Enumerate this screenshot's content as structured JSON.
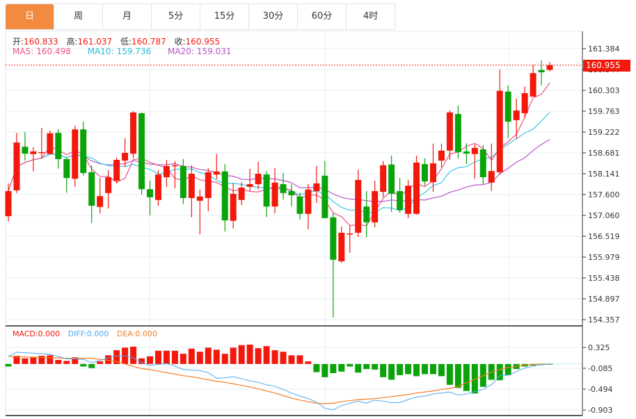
{
  "tabs": [
    "日",
    "周",
    "月",
    "5分",
    "15分",
    "30分",
    "60分",
    "4时"
  ],
  "active_tab": 0,
  "ohlc": {
    "open_label": "开:",
    "open": "160.833",
    "high_label": "高:",
    "high": "161.037",
    "low_label": "低:",
    "low": "160.787",
    "close_label": "收:",
    "close": "160.955"
  },
  "ma": {
    "ma5_label": "MA5:",
    "ma5": "160.498",
    "ma10_label": "MA10:",
    "ma10": "159.736",
    "ma20_label": "MA20:",
    "ma20": "159.031"
  },
  "macd_legend": {
    "macd": "MACD:0.000",
    "diff": "DIFF:0.000",
    "dea": "DEA:0.000"
  },
  "current_price": "160.955",
  "colors": {
    "up": "#f2180c",
    "down": "#0aa40a",
    "ma5": "#f0508a",
    "ma10": "#3cc8e0",
    "ma20": "#b855c8",
    "diff": "#4aa8f0",
    "dea": "#f57c1f",
    "accent": "#f28a3f"
  },
  "chart_data": {
    "type": "candlestick",
    "price_axis": {
      "ticks": [
        "161.384",
        "160.844",
        "160.303",
        "159.763",
        "159.222",
        "158.681",
        "158.141",
        "157.600",
        "157.060",
        "156.519",
        "155.979",
        "155.438",
        "154.897",
        "154.357"
      ],
      "range": [
        154.357,
        161.384
      ]
    },
    "macd_axis": {
      "ticks": [
        "0.325",
        "-0.085",
        "-0.494",
        "-0.903"
      ]
    },
    "candles": [
      [
        157.04,
        157.89,
        156.9,
        157.69
      ],
      [
        157.71,
        159.2,
        157.64,
        158.95
      ],
      [
        158.84,
        159.22,
        158.48,
        158.66
      ],
      [
        158.65,
        158.83,
        158.2,
        158.72
      ],
      [
        158.7,
        159.33,
        158.54,
        158.7
      ],
      [
        158.65,
        159.26,
        158.65,
        159.19
      ],
      [
        159.2,
        159.29,
        158.27,
        158.52
      ],
      [
        158.52,
        158.57,
        157.65,
        158.03
      ],
      [
        158.01,
        159.38,
        157.8,
        159.29
      ],
      [
        159.29,
        159.49,
        158.09,
        158.16
      ],
      [
        158.18,
        158.36,
        156.86,
        157.31
      ],
      [
        157.28,
        158.03,
        157.11,
        157.56
      ],
      [
        157.64,
        158.23,
        157.24,
        158.05
      ],
      [
        157.96,
        158.56,
        157.89,
        158.5
      ],
      [
        158.48,
        159.06,
        158.32,
        158.68
      ],
      [
        158.66,
        159.76,
        158.54,
        159.73
      ],
      [
        159.71,
        159.73,
        157.6,
        157.74
      ],
      [
        157.74,
        157.96,
        157.06,
        157.53
      ],
      [
        157.46,
        158.23,
        157.31,
        158.12
      ],
      [
        158.05,
        158.5,
        157.8,
        158.34
      ],
      [
        158.36,
        158.47,
        157.76,
        158.36
      ],
      [
        158.34,
        158.52,
        157.35,
        157.51
      ],
      [
        157.51,
        158.36,
        157.01,
        158.14
      ],
      [
        157.44,
        157.73,
        156.57,
        157.55
      ],
      [
        157.51,
        158.29,
        157.17,
        158.18
      ],
      [
        158.12,
        158.65,
        158.0,
        158.2
      ],
      [
        158.2,
        158.39,
        156.64,
        156.93
      ],
      [
        156.92,
        157.89,
        156.72,
        157.62
      ],
      [
        157.46,
        157.92,
        157.33,
        157.78
      ],
      [
        157.8,
        158.27,
        157.69,
        157.87
      ],
      [
        157.87,
        158.45,
        157.74,
        158.14
      ],
      [
        158.12,
        158.21,
        157.02,
        157.29
      ],
      [
        157.29,
        158.29,
        157.11,
        157.91
      ],
      [
        157.87,
        158.16,
        157.47,
        157.64
      ],
      [
        157.69,
        157.87,
        157.29,
        157.58
      ],
      [
        157.55,
        157.65,
        156.95,
        157.1
      ],
      [
        157.1,
        157.87,
        156.7,
        157.73
      ],
      [
        157.69,
        158.34,
        157.38,
        157.89
      ],
      [
        158.09,
        158.47,
        156.99,
        156.99
      ],
      [
        157.01,
        157.13,
        154.41,
        155.91
      ],
      [
        155.87,
        156.77,
        155.83,
        156.61
      ],
      [
        156.59,
        156.79,
        156.09,
        156.59
      ],
      [
        156.61,
        158.25,
        156.5,
        157.98
      ],
      [
        157.29,
        157.69,
        156.5,
        156.88
      ],
      [
        156.88,
        157.96,
        156.75,
        157.69
      ],
      [
        157.67,
        158.47,
        157.53,
        158.36
      ],
      [
        158.38,
        158.61,
        157.15,
        157.62
      ],
      [
        157.69,
        158.03,
        157.13,
        157.2
      ],
      [
        157.1,
        157.98,
        156.99,
        157.83
      ],
      [
        157.1,
        158.61,
        157.08,
        158.43
      ],
      [
        158.39,
        158.54,
        157.83,
        157.94
      ],
      [
        157.92,
        158.92,
        157.67,
        158.41
      ],
      [
        158.48,
        158.92,
        158.3,
        158.74
      ],
      [
        158.74,
        159.78,
        158.5,
        159.73
      ],
      [
        159.69,
        159.91,
        158.54,
        158.7
      ],
      [
        158.72,
        158.93,
        158.39,
        158.66
      ],
      [
        158.65,
        158.9,
        158.01,
        158.81
      ],
      [
        158.77,
        158.88,
        157.87,
        158.05
      ],
      [
        157.91,
        158.92,
        157.69,
        158.21
      ],
      [
        158.18,
        160.84,
        158.12,
        160.29
      ],
      [
        160.27,
        160.43,
        159.06,
        159.49
      ],
      [
        159.53,
        160.09,
        159.04,
        159.78
      ],
      [
        159.71,
        160.4,
        159.58,
        160.23
      ],
      [
        160.14,
        160.97,
        160.14,
        160.75
      ],
      [
        160.83,
        161.08,
        160.43,
        160.77
      ],
      [
        160.833,
        161.037,
        160.787,
        160.955
      ]
    ],
    "macd_hist": [
      -0.05,
      0.16,
      0.11,
      0.14,
      0.16,
      0.17,
      0.08,
      0.06,
      0.13,
      -0.05,
      -0.08,
      0.05,
      0.17,
      0.27,
      0.32,
      0.34,
      0.11,
      0.15,
      0.26,
      0.26,
      0.26,
      0.2,
      0.3,
      0.24,
      0.32,
      0.28,
      0.2,
      0.32,
      0.37,
      0.38,
      0.31,
      0.35,
      0.27,
      0.24,
      0.17,
      0.17,
      0.05,
      -0.16,
      -0.26,
      -0.18,
      -0.15,
      -0.05,
      -0.17,
      -0.1,
      -0.11,
      -0.26,
      -0.31,
      -0.22,
      -0.2,
      -0.24,
      -0.2,
      -0.2,
      -0.24,
      -0.41,
      -0.47,
      -0.53,
      -0.58,
      -0.45,
      -0.31,
      -0.32,
      -0.22,
      -0.1,
      -0.05,
      -0.03,
      -0.02,
      -0.01
    ],
    "dea": [
      0.15,
      0.14,
      0.14,
      0.13,
      0.13,
      0.12,
      0.12,
      0.11,
      0.11,
      0.11,
      0.11,
      0.09,
      0.07,
      0.05,
      0,
      -0.05,
      -0.09,
      -0.11,
      -0.14,
      -0.17,
      -0.2,
      -0.23,
      -0.25,
      -0.28,
      -0.31,
      -0.34,
      -0.36,
      -0.39,
      -0.42,
      -0.45,
      -0.49,
      -0.53,
      -0.57,
      -0.62,
      -0.67,
      -0.71,
      -0.74,
      -0.77,
      -0.78,
      -0.77,
      -0.74,
      -0.72,
      -0.7,
      -0.69,
      -0.68,
      -0.66,
      -0.64,
      -0.62,
      -0.6,
      -0.57,
      -0.55,
      -0.53,
      -0.5,
      -0.48,
      -0.44,
      -0.37,
      -0.3,
      -0.23,
      -0.16,
      -0.11,
      -0.07,
      -0.05,
      -0.02,
      -0.01,
      0,
      0
    ],
    "diff": [
      0.15,
      0.23,
      0.22,
      0.21,
      0.2,
      0.19,
      0.15,
      0.1,
      0.1,
      0.09,
      0.03,
      0.07,
      0.12,
      0.16,
      0.16,
      0.12,
      0.03,
      -0.03,
      -0.01,
      0.01,
      -0.04,
      -0.11,
      -0.12,
      -0.13,
      -0.17,
      -0.28,
      -0.27,
      -0.25,
      -0.29,
      -0.33,
      -0.36,
      -0.41,
      -0.44,
      -0.5,
      -0.57,
      -0.63,
      -0.68,
      -0.75,
      -0.87,
      -0.9,
      -0.82,
      -0.77,
      -0.73,
      -0.77,
      -0.71,
      -0.73,
      -0.76,
      -0.76,
      -0.7,
      -0.65,
      -0.63,
      -0.59,
      -0.57,
      -0.55,
      -0.61,
      -0.59,
      -0.54,
      -0.5,
      -0.41,
      -0.23,
      -0.22,
      -0.15,
      -0.08,
      -0.04,
      -0.01,
      0
    ]
  }
}
